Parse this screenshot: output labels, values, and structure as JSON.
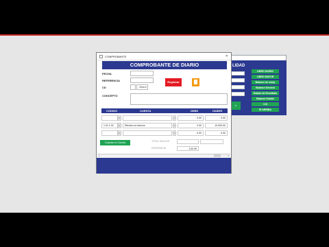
{
  "background_window": {
    "title": "LIDAD",
    "fields": [
      "",
      "",
      "",
      ""
    ],
    "buttons": [
      "LIBRO DIARIO",
      "LIBRO MAYOR",
      "Balance de comp",
      "Balance General",
      "Estado de Resultado",
      "Balance Detalle",
      "C/S",
      "IR ARRIBA"
    ],
    "small_button": "e"
  },
  "main_window": {
    "title": "COMPROBANTE",
    "header": "COMPROBANTE DE DIARIO",
    "labels": {
      "fecha": "FECHA",
      "referencia": "REFERENCIA",
      "cd": "CD",
      "concepto": "CONCEPTO"
    },
    "cd_value": "Ahorro",
    "register_button": "Registrar",
    "table": {
      "headers": [
        "CODIGO",
        "CUENTA",
        "DEBE",
        "HABER"
      ],
      "rows": [
        {
          "codigo": "",
          "cuenta": "",
          "debe": "0.00",
          "haber": "0.00"
        },
        {
          "codigo": "1.01.1.02",
          "cuenta": "Efectivo en bancos",
          "debe": "0.00",
          "haber": "10,000.00"
        },
        {
          "codigo": "",
          "cuenta": "",
          "debe": "0.00",
          "haber": "0.00"
        }
      ]
    },
    "add_button": "Guardar en Cuenta",
    "totals": {
      "label1": "TOTAL SALDOS",
      "label2": "DIFERENCIA",
      "diff_value": "1,00.00"
    }
  }
}
